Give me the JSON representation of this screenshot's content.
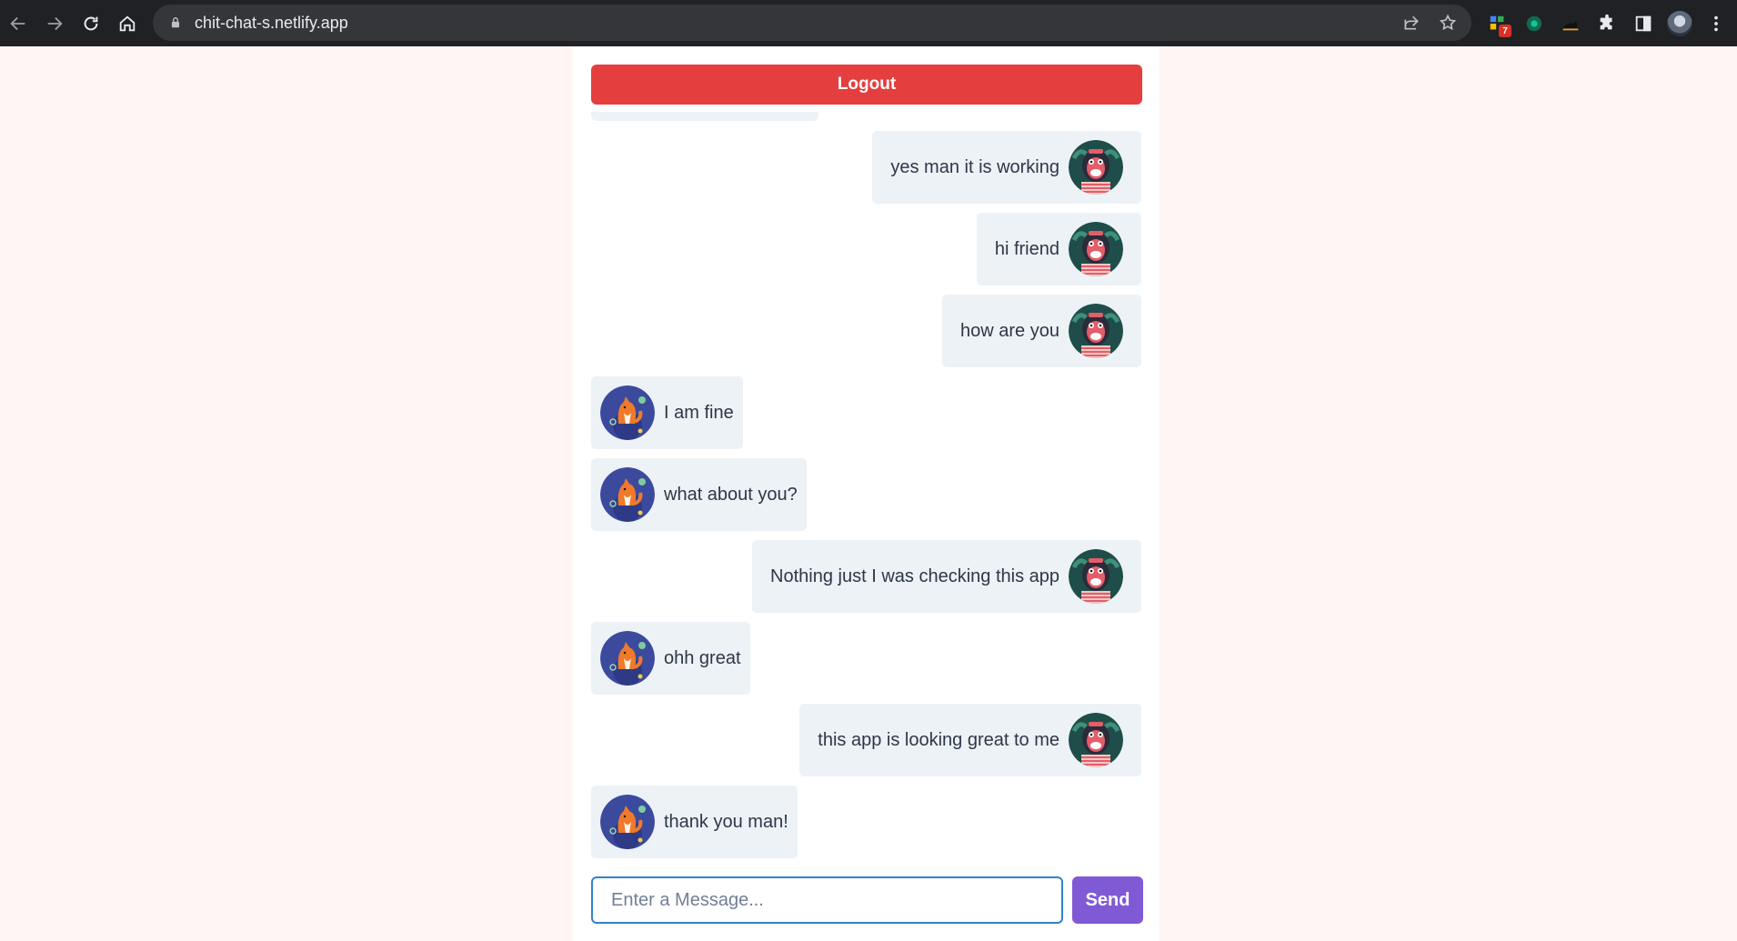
{
  "browser": {
    "url": "chit-chat-s.netlify.app",
    "extension_badge": "7",
    "icons": [
      "back-icon",
      "forward-icon",
      "reload-icon",
      "home-icon",
      "lock-icon",
      "share-icon",
      "star-icon",
      "extensions-icon",
      "side-panel-icon",
      "profile-avatar",
      "menu-icon"
    ]
  },
  "chat": {
    "logout_label": "Logout",
    "messages": [
      {
        "text": "yes man it is working",
        "sender": "self",
        "avatar": "monkey-avatar"
      },
      {
        "text": "hi friend",
        "sender": "self",
        "avatar": "monkey-avatar"
      },
      {
        "text": "how are you",
        "sender": "self",
        "avatar": "monkey-avatar"
      },
      {
        "text": "I am fine",
        "sender": "other",
        "avatar": "fox-avatar"
      },
      {
        "text": "what about you?",
        "sender": "other",
        "avatar": "fox-avatar"
      },
      {
        "text": "Nothing just I was checking this app",
        "sender": "self",
        "avatar": "monkey-avatar"
      },
      {
        "text": "ohh great",
        "sender": "other",
        "avatar": "fox-avatar"
      },
      {
        "text": "this app is looking great to me",
        "sender": "self",
        "avatar": "monkey-avatar"
      },
      {
        "text": "thank you man!",
        "sender": "other",
        "avatar": "fox-avatar"
      }
    ],
    "input": {
      "value": "",
      "placeholder": "Enter a Message..."
    },
    "send_label": "Send"
  },
  "colors": {
    "page_bg": "#fff5f5",
    "logout": "#e53e3e",
    "send": "#805ad5",
    "bubble": "#edf2f7",
    "input_border": "#3182ce"
  }
}
